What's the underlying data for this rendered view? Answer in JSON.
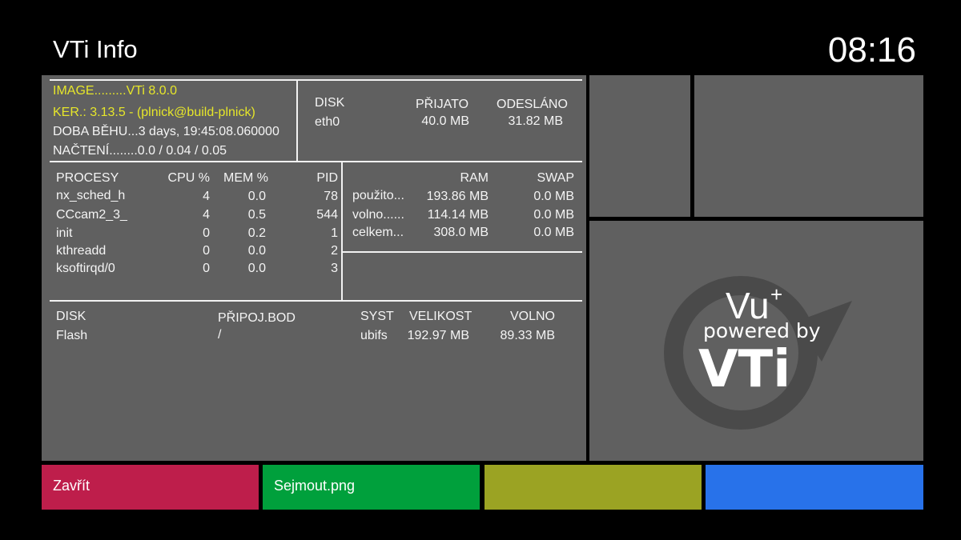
{
  "header": {
    "title": "VTi Info",
    "clock": "08:16"
  },
  "image_info": {
    "image": "IMAGE.........VTi 8.0.0",
    "kernel": "KER.: 3.13.5 - (plnick@build-plnick)",
    "uptime": "DOBA BĚHU...3 days, 19:45:08.060000",
    "load": "NAČTENÍ........0.0 / 0.04 / 0.05"
  },
  "network": {
    "headers": [
      "DISK",
      "PŘIJATO",
      "ODESLÁNO"
    ],
    "rows": [
      {
        "name": "eth0",
        "received": "40.0 MB",
        "sent": "31.82 MB"
      }
    ]
  },
  "processes": {
    "headers": [
      "PROCESY",
      "CPU %",
      "MEM %",
      "PID"
    ],
    "rows": [
      {
        "name": "nx_sched_h",
        "cpu": "4",
        "mem": "0.0",
        "pid": "78"
      },
      {
        "name": "CCcam2_3_",
        "cpu": "4",
        "mem": "0.5",
        "pid": "544"
      },
      {
        "name": "init",
        "cpu": "0",
        "mem": "0.2",
        "pid": "1"
      },
      {
        "name": "kthreadd",
        "cpu": "0",
        "mem": "0.0",
        "pid": "2"
      },
      {
        "name": "ksoftirqd/0",
        "cpu": "0",
        "mem": "0.0",
        "pid": "3"
      }
    ]
  },
  "memory": {
    "headers": [
      "RAM",
      "SWAP"
    ],
    "rows": [
      {
        "label": "použito...",
        "ram": "193.86 MB",
        "swap": "0.0 MB"
      },
      {
        "label": "volno......",
        "ram": "114.14 MB",
        "swap": "0.0 MB"
      },
      {
        "label": "celkem...",
        "ram": "308.0 MB",
        "swap": "0.0 MB"
      }
    ]
  },
  "storage": {
    "headers": [
      "DISK",
      "PŘIPOJ.BOD",
      "SYST",
      "VELIKOST",
      "VOLNO"
    ],
    "rows": [
      {
        "disk": "Flash",
        "mount": "/",
        "fs": "ubifs",
        "size": "192.97 MB",
        "free": "89.33 MB"
      }
    ]
  },
  "logo": {
    "line1": "Vu",
    "plus": "+",
    "line2": "powered by",
    "line3": "VTi"
  },
  "buttons": {
    "red": "Zavřít",
    "green": "Sejmout.png",
    "yellow": "",
    "blue": ""
  },
  "colors": {
    "red": "#be1e4b",
    "green": "#00a03c",
    "yellow": "#9ba323",
    "blue": "#2872ea",
    "panel": "#606060",
    "highlight": "#e6e62a"
  }
}
